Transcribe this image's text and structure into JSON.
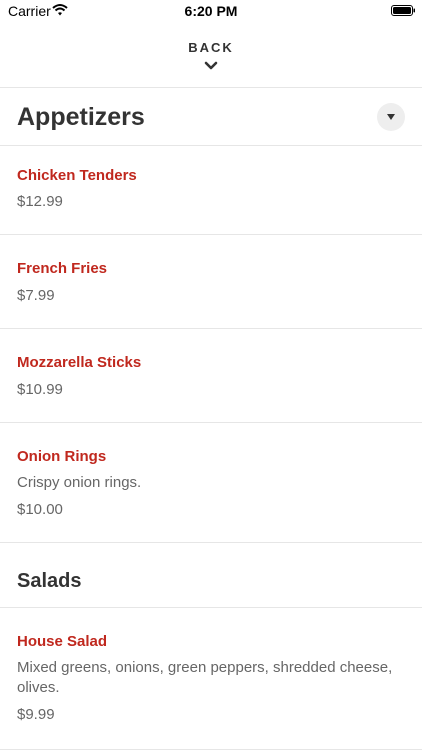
{
  "status_bar": {
    "carrier": "Carrier",
    "time": "6:20 PM"
  },
  "header": {
    "back_label": "BACK"
  },
  "sections": [
    {
      "title": "Appetizers",
      "items": [
        {
          "name": "Chicken Tenders",
          "price": "$12.99"
        },
        {
          "name": "French Fries",
          "price": "$7.99"
        },
        {
          "name": "Mozzarella Sticks",
          "price": "$10.99"
        },
        {
          "name": "Onion Rings",
          "description": "Crispy onion rings.",
          "price": "$10.00"
        }
      ]
    },
    {
      "title": "Salads",
      "items": [
        {
          "name": "House Salad",
          "description": "Mixed greens, onions, green peppers, shredded cheese, olives.",
          "price": "$9.99"
        }
      ]
    }
  ],
  "colors": {
    "item_name": "#c0281e",
    "text": "#333333",
    "secondary_text": "#666666",
    "divider": "#e6e6e6"
  }
}
